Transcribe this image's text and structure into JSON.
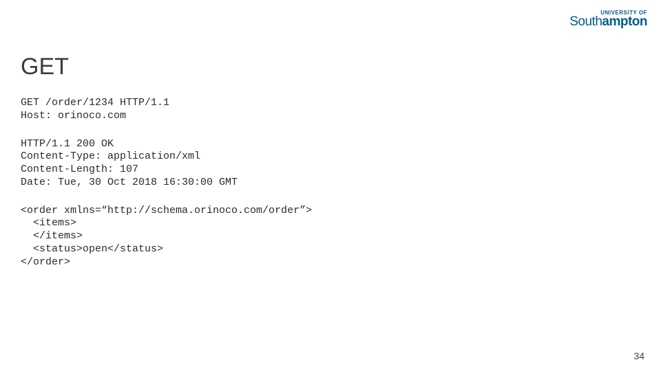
{
  "logo": {
    "top": "UNIVERSITY OF",
    "bottom_light": "South",
    "bottom_bold": "ampton"
  },
  "slide": {
    "title": "GET",
    "request": "GET /order/1234 HTTP/1.1\nHost: orinoco.com",
    "response_headers": "HTTP/1.1 200 OK\nContent-Type: application/xml\nContent-Length: 107\nDate: Tue, 30 Oct 2018 16:30:00 GMT",
    "response_body": "<order xmlns=“http://schema.orinoco.com/order”>\n  <items>\n  </items>\n  <status>open</status>\n</order>",
    "pagenum": "34"
  }
}
